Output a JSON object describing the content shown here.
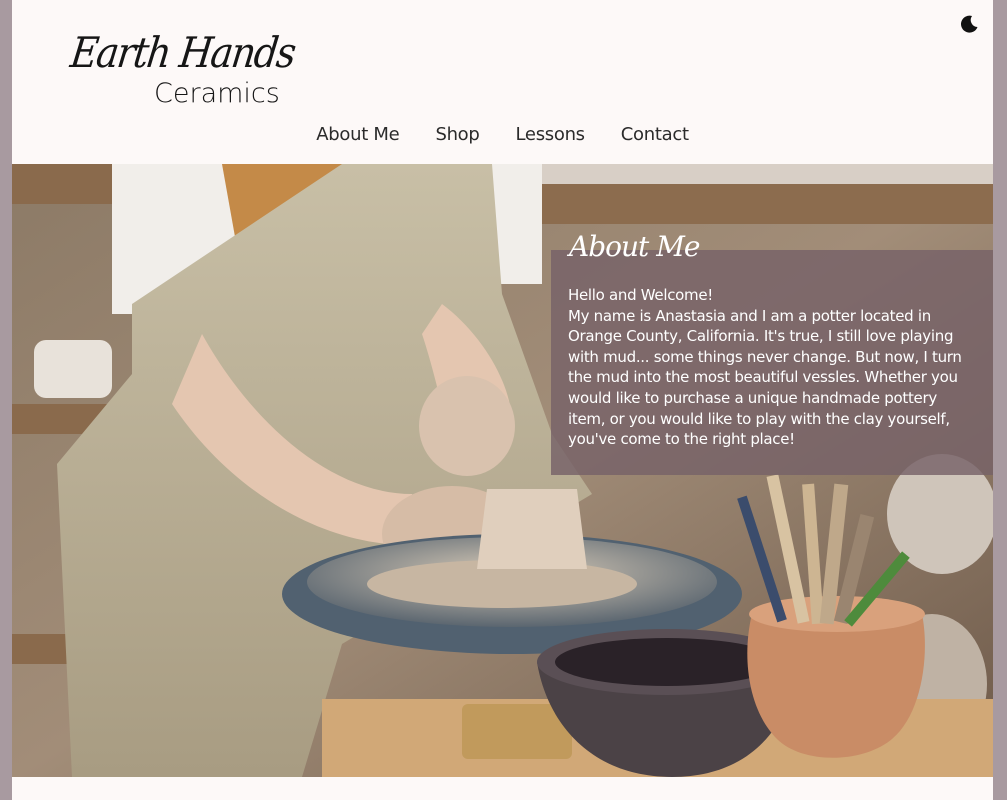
{
  "brand": {
    "script": "Earth Hands",
    "sub": "Ceramics"
  },
  "theme_toggle": {
    "icon": "moon-icon"
  },
  "nav": {
    "items": [
      {
        "label": "About Me"
      },
      {
        "label": "Shop"
      },
      {
        "label": "Lessons"
      },
      {
        "label": "Contact"
      }
    ]
  },
  "about": {
    "title": "About Me",
    "greeting": "Hello and Welcome!",
    "body": "My name is Anastasia and I am a potter located in Orange County, California. It's true, I still love playing with mud... some things never change. But now, I turn the mud into the most beautiful vessles. Whether you would like to purchase a unique handmade pottery item, or you would like to play with the clay yourself, you've come to the right place!"
  },
  "colors": {
    "frame": "#a89aa0",
    "page_bg": "#fdf9f8",
    "overlay": "#766268"
  }
}
